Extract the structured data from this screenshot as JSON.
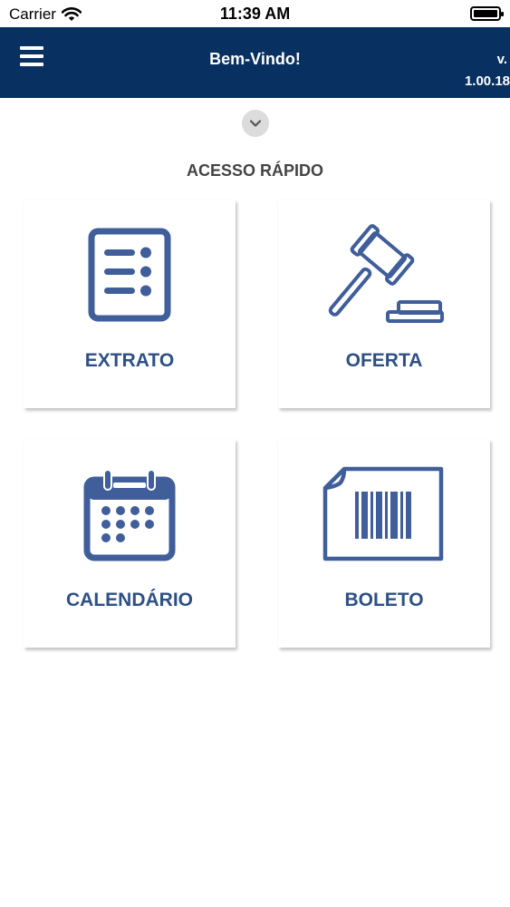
{
  "status_bar": {
    "carrier": "Carrier",
    "time": "11:39 AM"
  },
  "header": {
    "title": "Bem-Vindo!",
    "version_line1": "v.",
    "version_line2": "1.00.18"
  },
  "quick_access": {
    "title": "ACESSO RÁPIDO",
    "tiles": [
      {
        "label": "EXTRATO",
        "icon": "statement-list-icon"
      },
      {
        "label": "OFERTA",
        "icon": "gavel-icon"
      },
      {
        "label": "CALENDÁRIO",
        "icon": "calendar-icon"
      },
      {
        "label": "BOLETO",
        "icon": "barcode-document-icon"
      }
    ]
  },
  "colors": {
    "header_bg": "#083061",
    "accent": "#3f5e9a",
    "tile_label": "#2e5087"
  }
}
